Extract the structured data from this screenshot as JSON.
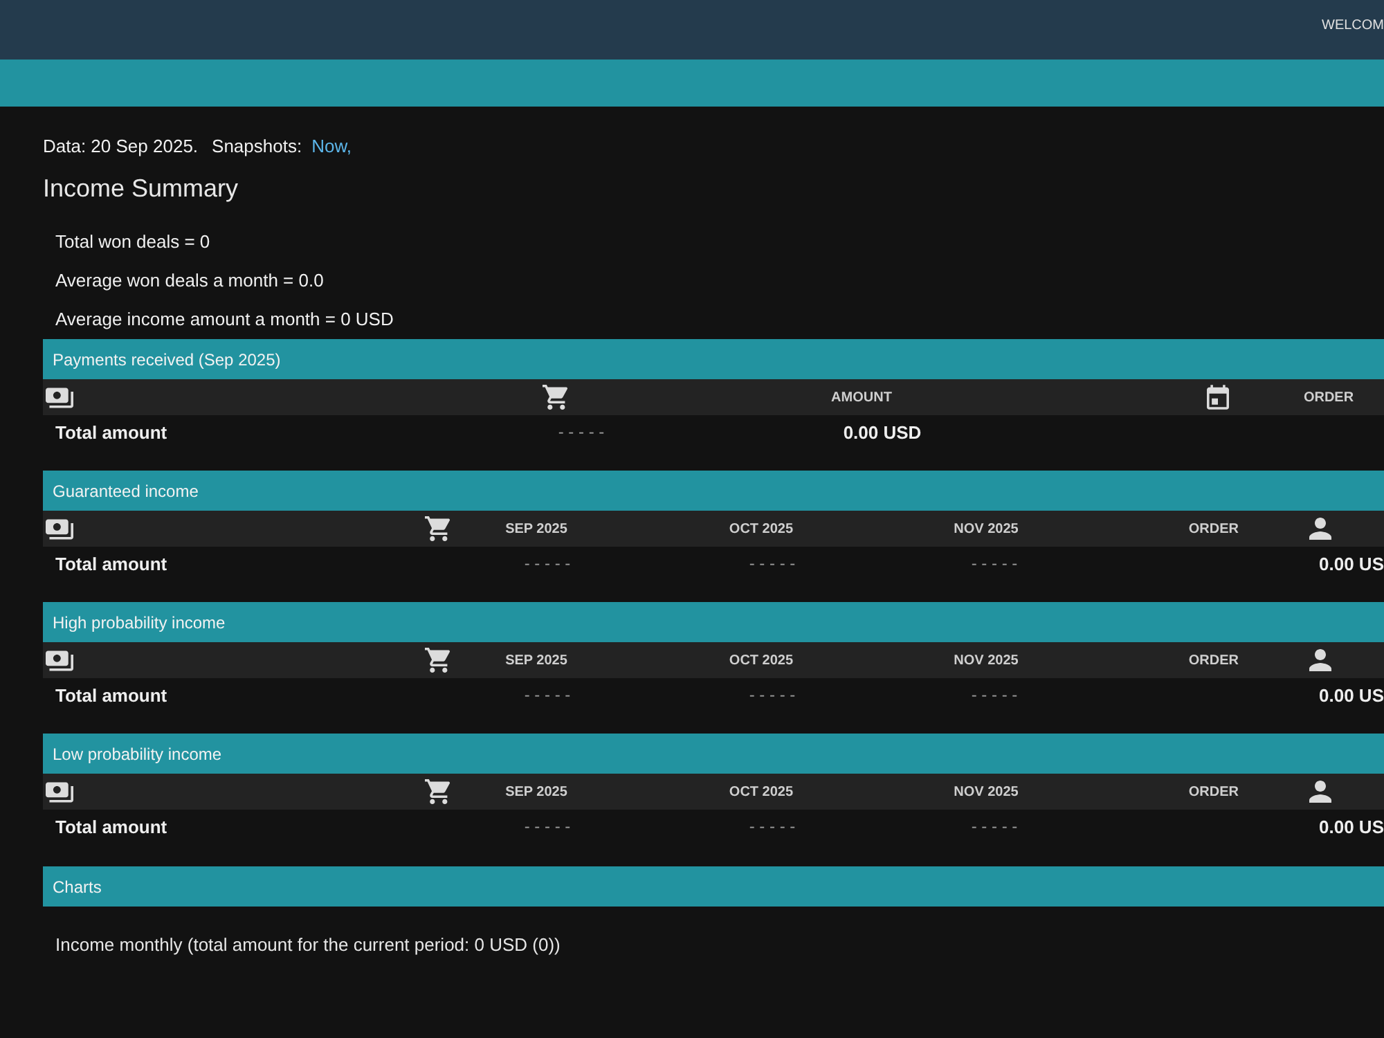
{
  "top_bar": {
    "welcome_text": "WELCOM"
  },
  "info": {
    "data_label": "Data: 20 Sep 2025.",
    "snapshots_label": "Snapshots:",
    "snapshot_link": "Now,"
  },
  "income_summary": {
    "title": "Income Summary",
    "lines": [
      "Total won deals = 0",
      "Average won deals a month = 0.0",
      "Average income amount a month = 0 USD"
    ]
  },
  "panels": [
    {
      "kind": "payments",
      "title": "Payments received (Sep 2025)",
      "columns": [
        "AMOUNT",
        "ORDER"
      ],
      "total": {
        "label": "Total amount",
        "cells": [
          "- - - - -",
          "0.00 USD"
        ]
      }
    },
    {
      "kind": "forecast",
      "title": "Guaranteed income",
      "columns": [
        "SEP 2025",
        "OCT 2025",
        "NOV 2025",
        "ORDER"
      ],
      "total": {
        "label": "Total amount",
        "cells": [
          "- - - - -",
          "- - - - -",
          "- - - - -",
          "0.00 US"
        ]
      }
    },
    {
      "kind": "forecast",
      "title": "High probability income",
      "columns": [
        "SEP 2025",
        "OCT 2025",
        "NOV 2025",
        "ORDER"
      ],
      "total": {
        "label": "Total amount",
        "cells": [
          "- - - - -",
          "- - - - -",
          "- - - - -",
          "0.00 US"
        ]
      }
    },
    {
      "kind": "forecast",
      "title": "Low probability income",
      "columns": [
        "SEP 2025",
        "OCT 2025",
        "NOV 2025",
        "ORDER"
      ],
      "total": {
        "label": "Total amount",
        "cells": [
          "- - - - -",
          "- - - - -",
          "- - - - -",
          "0.00 US"
        ]
      }
    }
  ],
  "charts": {
    "title": "Charts",
    "text": "Income monthly (total amount for the current period: 0 USD (0))"
  }
}
